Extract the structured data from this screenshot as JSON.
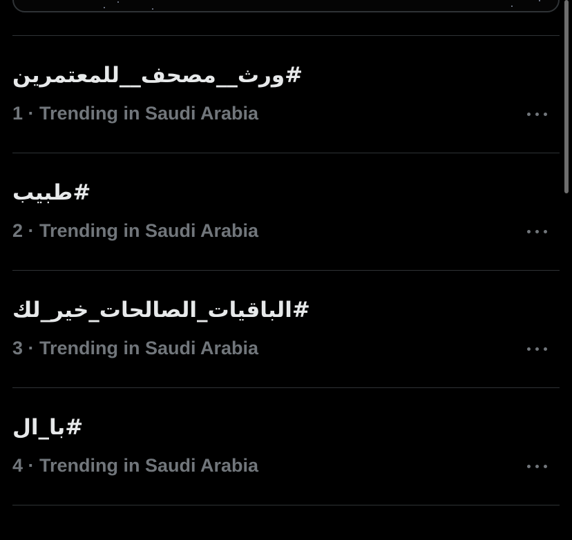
{
  "colors": {
    "background": "#000000",
    "primary_text": "#e7e9ea",
    "secondary_text": "#71767b",
    "divider": "#2f3336"
  },
  "trends": [
    {
      "name": "#ورث__مصحف__للمعتمرين",
      "meta": "1 · Trending in Saudi Arabia",
      "more_icon": "more-horizontal-icon"
    },
    {
      "name": "#طبيب",
      "meta": "2 · Trending in Saudi Arabia",
      "more_icon": "more-horizontal-icon"
    },
    {
      "name": "#الباقيات_الصالحات_خير_لك",
      "meta": "3 · Trending in Saudi Arabia",
      "more_icon": "more-horizontal-icon"
    },
    {
      "name": "#با_ال",
      "meta": "4 · Trending in Saudi Arabia",
      "more_icon": "more-horizontal-icon"
    }
  ]
}
